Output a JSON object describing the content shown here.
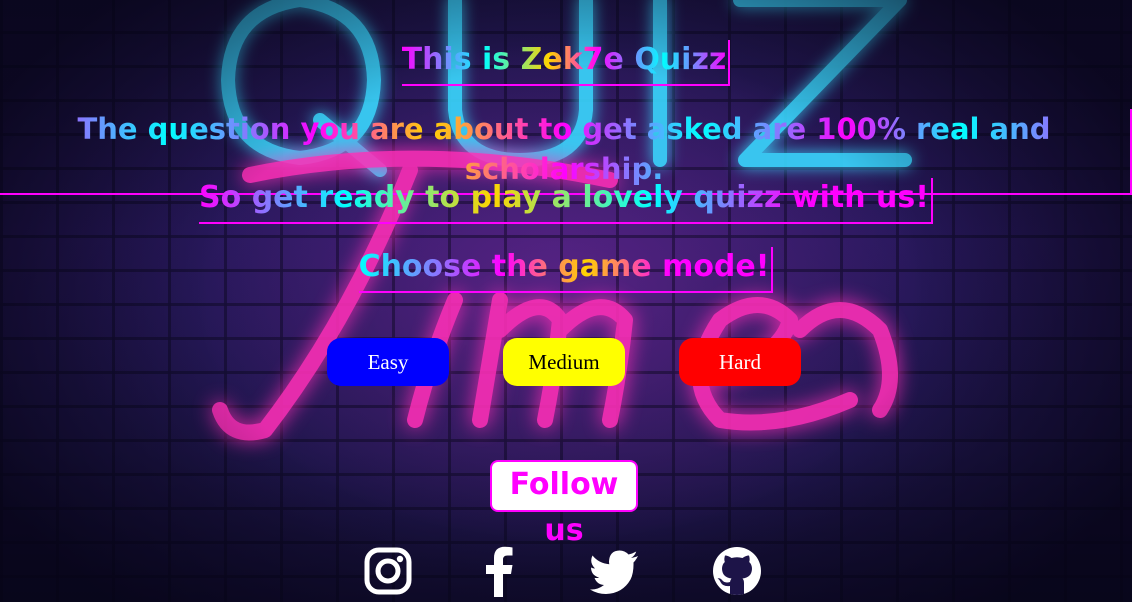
{
  "intro": {
    "line1": "This is Zek7e Quizz",
    "line2": "The question you are about to get asked are 100% real and scholarship.",
    "line3": "So get ready to play a lovely quizz with us!",
    "line4": "Choose the game mode!"
  },
  "modes": [
    {
      "label": "Easy",
      "bg": "#0000ff",
      "fg": "#ffffff"
    },
    {
      "label": "Medium",
      "bg": "#ffff00",
      "fg": "#000000"
    },
    {
      "label": "Hard",
      "bg": "#ff0000",
      "fg": "#ffffff"
    }
  ],
  "follow": {
    "label": "Follow us"
  },
  "socials": [
    {
      "icon": "instagram-icon"
    },
    {
      "icon": "facebook-icon"
    },
    {
      "icon": "twitter-icon"
    },
    {
      "icon": "github-icon"
    }
  ],
  "colors": {
    "magenta": "#ff00ff",
    "cyan": "#00ffff",
    "yellow": "#ffd400"
  }
}
